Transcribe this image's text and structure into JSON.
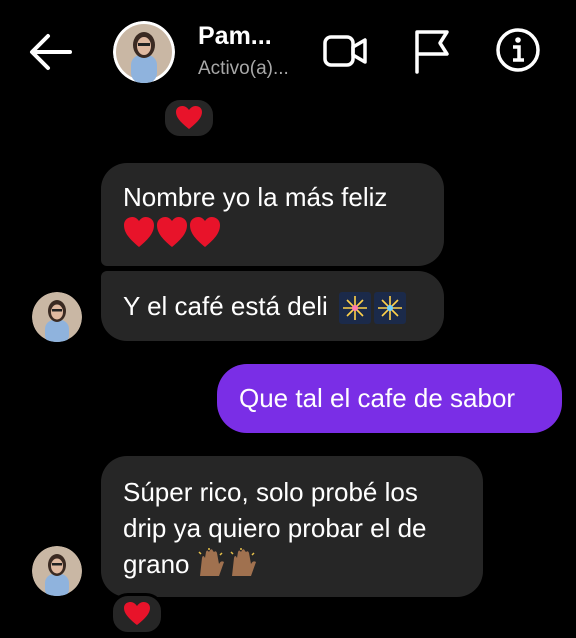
{
  "header": {
    "contact_name": "Pam...",
    "status": "Activo(a)...",
    "icons": [
      "arrow-left-icon",
      "video-call-icon",
      "flag-icon",
      "info-icon"
    ]
  },
  "messages": [
    {
      "from": "them",
      "text": "Nombre yo la más feliz",
      "emoji": "❤️❤️❤️"
    },
    {
      "from": "them",
      "text": "Y el café está deli",
      "emoji": "fireworks"
    },
    {
      "from": "me",
      "text": "Que tal el cafe de sabor"
    },
    {
      "from": "them",
      "text": "Súper rico, solo probé los drip ya quiero probar el de grano",
      "emoji": "raised-hands"
    }
  ],
  "reactions": [
    "❤️",
    "❤️"
  ],
  "colors": {
    "background": "#000000",
    "incoming_bubble": "#262626",
    "outgoing_bubble": "#7a2ee6",
    "status_text": "#a8a8a8"
  }
}
